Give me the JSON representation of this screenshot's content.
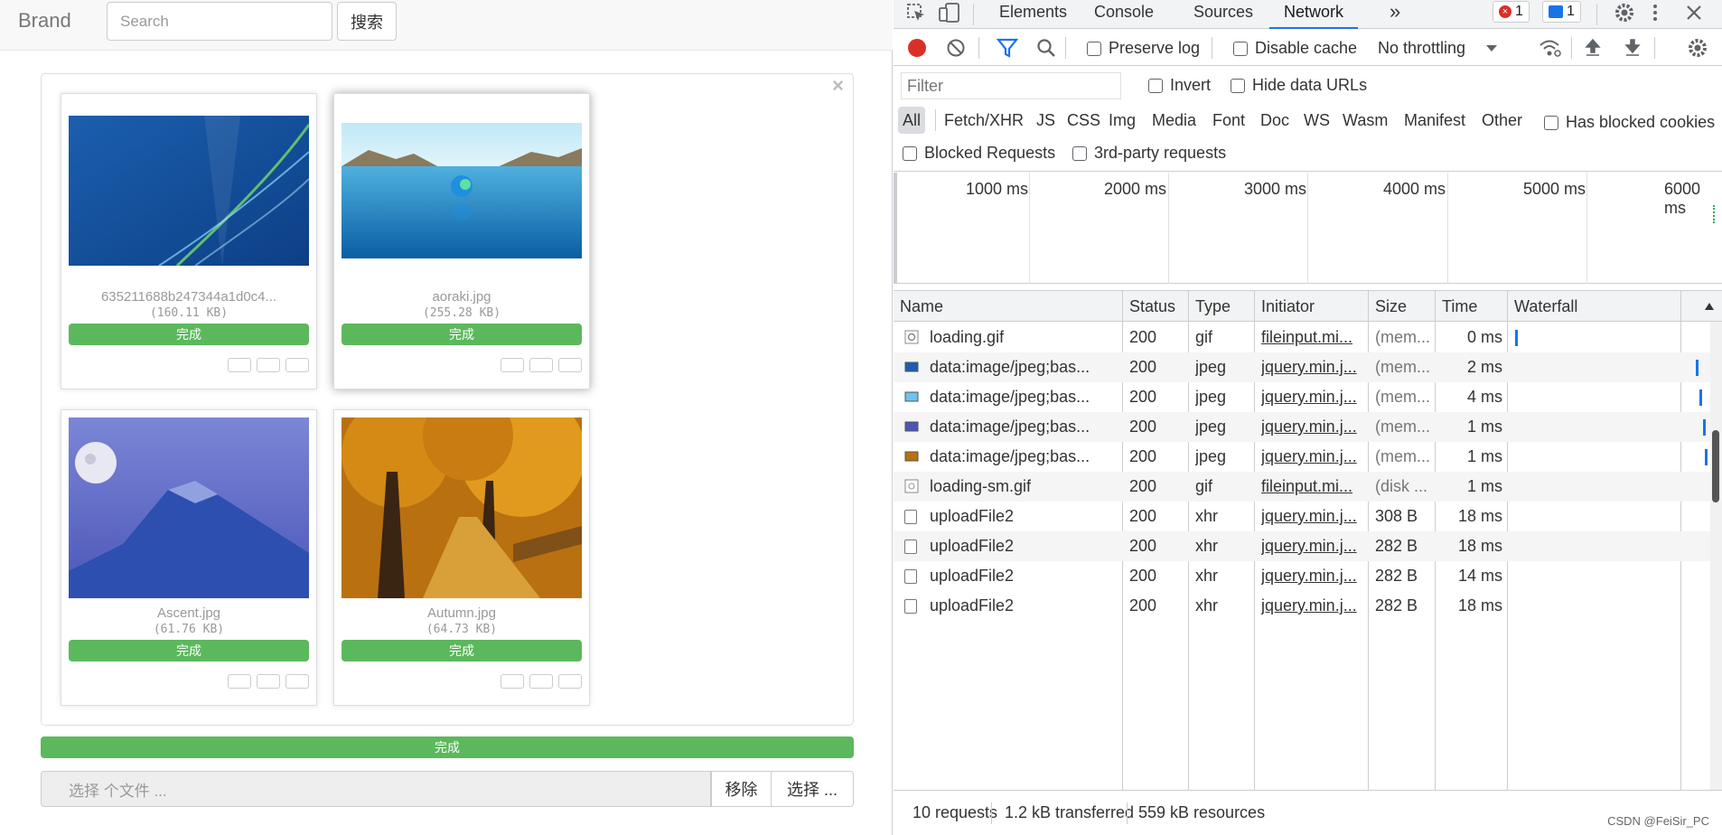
{
  "navbar": {
    "brand": "Brand",
    "search_placeholder": "Search",
    "search_button": "搜索"
  },
  "preview": {
    "close": "×",
    "thumbs": [
      {
        "caption": "635211688b247344a1d0c4...",
        "size": "(160.11 KB)",
        "status": "完成"
      },
      {
        "caption": "aoraki.jpg",
        "size": "(255.28 KB)",
        "status": "完成"
      },
      {
        "caption": "Ascent.jpg",
        "size": "(61.76 KB)",
        "status": "完成"
      },
      {
        "caption": "Autumn.jpg",
        "size": "(64.73 KB)",
        "status": "完成"
      }
    ],
    "progress_label": "完成",
    "file_caption": "选择 个文件 ...",
    "remove_button": "移除",
    "choose_button": "选择 ..."
  },
  "devtools": {
    "tabs": [
      "Elements",
      "Console",
      "Sources",
      "Network"
    ],
    "more_tabs": "»",
    "error_count": "1",
    "message_count": "1",
    "toolbar": {
      "preserve_log": "Preserve log",
      "disable_cache": "Disable cache",
      "throttling": "No throttling"
    },
    "filter": {
      "placeholder": "Filter",
      "invert": "Invert",
      "hide_data_urls": "Hide data URLs",
      "types": [
        "All",
        "Fetch/XHR",
        "JS",
        "CSS",
        "Img",
        "Media",
        "Font",
        "Doc",
        "WS",
        "Wasm",
        "Manifest",
        "Other"
      ],
      "has_blocked_cookies": "Has blocked cookies",
      "blocked_requests": "Blocked Requests",
      "third_party": "3rd-party requests"
    },
    "overview_ticks": [
      "1000 ms",
      "2000 ms",
      "3000 ms",
      "4000 ms",
      "5000 ms",
      "6000 ms"
    ],
    "columns": [
      "Name",
      "Status",
      "Type",
      "Initiator",
      "Size",
      "Time",
      "Waterfall"
    ],
    "rows": [
      {
        "name": "loading.gif",
        "status": "200",
        "type": "gif",
        "initiator": "fileinput.mi...",
        "size": "(mem...",
        "time": "0 ms"
      },
      {
        "name": "data:image/jpeg;bas...",
        "status": "200",
        "type": "jpeg",
        "initiator": "jquery.min.j...",
        "size": "(mem...",
        "time": "2 ms"
      },
      {
        "name": "data:image/jpeg;bas...",
        "status": "200",
        "type": "jpeg",
        "initiator": "jquery.min.j...",
        "size": "(mem...",
        "time": "4 ms"
      },
      {
        "name": "data:image/jpeg;bas...",
        "status": "200",
        "type": "jpeg",
        "initiator": "jquery.min.j...",
        "size": "(mem...",
        "time": "1 ms"
      },
      {
        "name": "data:image/jpeg;bas...",
        "status": "200",
        "type": "jpeg",
        "initiator": "jquery.min.j...",
        "size": "(mem...",
        "time": "1 ms"
      },
      {
        "name": "loading-sm.gif",
        "status": "200",
        "type": "gif",
        "initiator": "fileinput.mi...",
        "size": "(disk ...",
        "time": "1 ms"
      },
      {
        "name": "uploadFile2",
        "status": "200",
        "type": "xhr",
        "initiator": "jquery.min.j...",
        "size": "308 B",
        "time": "18 ms"
      },
      {
        "name": "uploadFile2",
        "status": "200",
        "type": "xhr",
        "initiator": "jquery.min.j...",
        "size": "282 B",
        "time": "18 ms"
      },
      {
        "name": "uploadFile2",
        "status": "200",
        "type": "xhr",
        "initiator": "jquery.min.j...",
        "size": "282 B",
        "time": "14 ms"
      },
      {
        "name": "uploadFile2",
        "status": "200",
        "type": "xhr",
        "initiator": "jquery.min.j...",
        "size": "282 B",
        "time": "18 ms"
      }
    ],
    "status_bar": {
      "requests": "10 requests",
      "transferred": "1.2 kB transferred",
      "resources": "559 kB resources"
    },
    "watermark": "CSDN @FeiSir_PC"
  },
  "colors": {
    "success": "#5cb85c",
    "accent": "#1a73e8",
    "record": "#d93025"
  }
}
